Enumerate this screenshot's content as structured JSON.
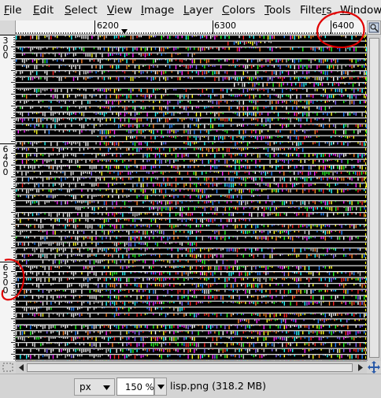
{
  "menubar": {
    "items": [
      {
        "label": "File",
        "mnemonic": "F",
        "rest": "ile"
      },
      {
        "label": "Edit",
        "mnemonic": "E",
        "rest": "dit"
      },
      {
        "label": "Select",
        "mnemonic": "S",
        "rest": "elect"
      },
      {
        "label": "View",
        "mnemonic": "V",
        "rest": "iew"
      },
      {
        "label": "Image",
        "mnemonic": "I",
        "rest": "mage"
      },
      {
        "label": "Layer",
        "mnemonic": "L",
        "rest": "ayer"
      },
      {
        "label": "Colors",
        "mnemonic": "C",
        "rest": "olors"
      },
      {
        "label": "Tools",
        "mnemonic": "T",
        "rest": "ools"
      },
      {
        "label": "Filters",
        "mnemonic": "r",
        "rest": ""
      },
      {
        "label": "Windows",
        "mnemonic": "W",
        "rest": "indows"
      }
    ]
  },
  "ruler_h": {
    "labels": [
      "6200",
      "6300",
      "6400"
    ]
  },
  "ruler_v": {
    "labels": [
      [
        "3",
        "0",
        "0"
      ],
      [
        "6",
        "4",
        "0",
        "0"
      ],
      [
        "6",
        "5",
        "0",
        "0"
      ]
    ]
  },
  "icons": {
    "navigate": "navigate-icon",
    "quick_mask": "quick-mask-icon",
    "navigate_corner": "navigate-cross-icon",
    "scroll_left": "arrow-left-icon",
    "scroll_right": "arrow-right-icon",
    "dropdown": "chevron-down-icon"
  },
  "annotation_color": "#e00000",
  "status": {
    "unit": "px",
    "zoom": "150 %",
    "text": "lisp.png (318.2 MB)"
  }
}
